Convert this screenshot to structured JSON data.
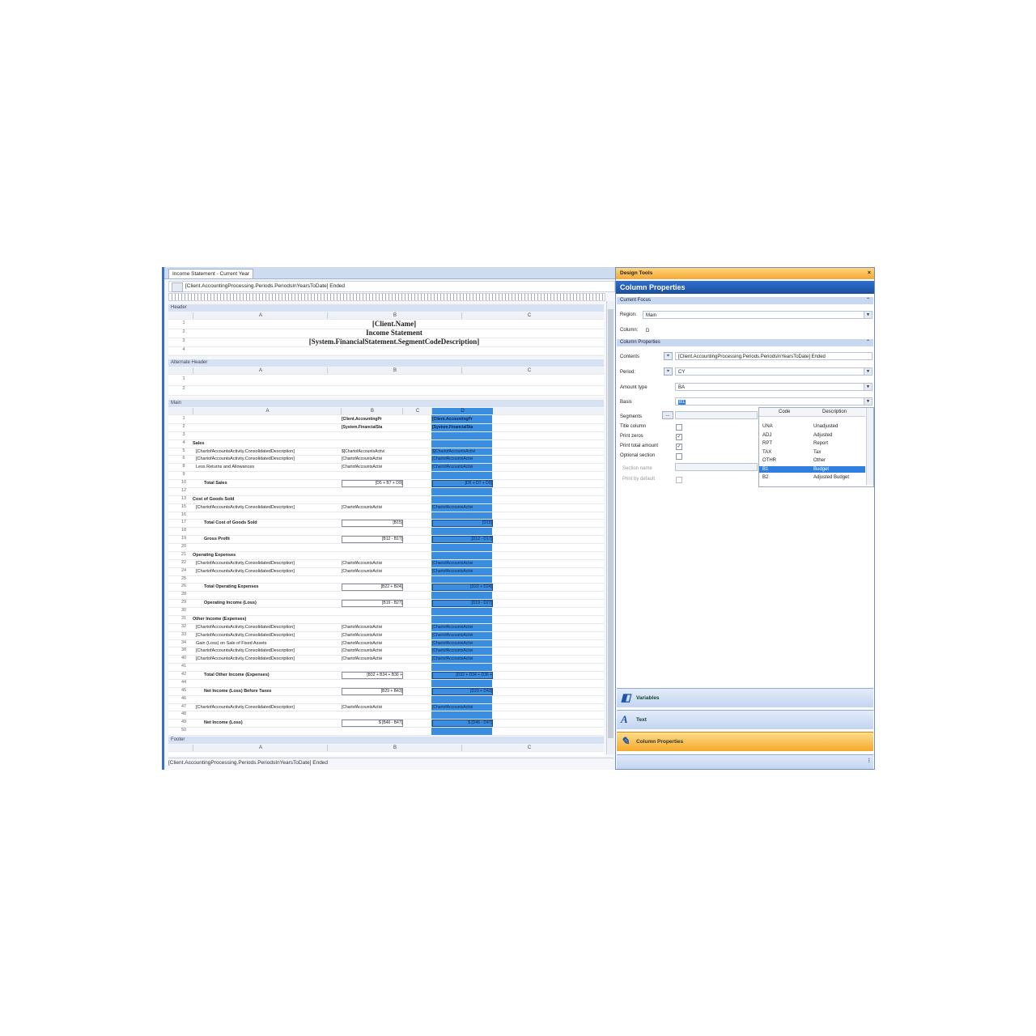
{
  "document_tab": "Income Statement - Current Year",
  "formula_bar": "[Client.AccountingProcessing.Periods.PeriodsInYearsToDate] Ended",
  "sections": {
    "header": "Header",
    "alt_header": "Alternate Header",
    "main": "Main",
    "footer": "Footer"
  },
  "columns": {
    "a": "A",
    "b": "B",
    "c": "C",
    "d": "D"
  },
  "header_rows": [
    {
      "n": "1",
      "text": "[Client.Name]"
    },
    {
      "n": "2",
      "text": "Income Statement"
    },
    {
      "n": "3",
      "text": "[System.FinancialStatement.SegmentCodeDescription]"
    },
    {
      "n": "4",
      "text": ""
    }
  ],
  "alt_header_rows": [
    "1",
    "2"
  ],
  "main_rows": [
    {
      "n": "1",
      "a": "",
      "b": "[Client.AccountingPr",
      "d": "[Client.AccountingPr",
      "bold": true
    },
    {
      "n": "2",
      "a": "",
      "b": "[System.FinancialSta",
      "d": "[System.FinancialSta",
      "bold": true
    },
    {
      "n": "3",
      "a": "",
      "b": "",
      "d": ""
    },
    {
      "n": "4",
      "a": "Sales",
      "b": "",
      "d": "",
      "bold": true
    },
    {
      "n": "5",
      "a": "[ChartofAccountsActivity.ConsolidatedDescription]",
      "b": "$[ChartofAccountsActivi",
      "d": "$[ChartofAccountsActivi"
    },
    {
      "n": "6",
      "a": "[ChartofAccountsActivity.ConsolidatedDescription]",
      "b": "[ChartofAccountsActivi",
      "d": "[ChartofAccountsActivi"
    },
    {
      "n": "8",
      "a": "Less Returns and Allowances",
      "b": "[ChartofAccountsActivi",
      "d": "[ChartofAccountsActivi"
    },
    {
      "n": "9",
      "a": "",
      "b": "",
      "d": ""
    },
    {
      "n": "10",
      "a": "Total Sales",
      "b": "[D5 + B7 + D9]",
      "d": "[D5 + D7 + D9]",
      "bold": true,
      "boxed": true
    },
    {
      "n": "12",
      "a": "",
      "b": "",
      "d": ""
    },
    {
      "n": "13",
      "a": "Cost of Goods Sold",
      "b": "",
      "d": "",
      "bold": true
    },
    {
      "n": "15",
      "a": "[ChartofAccountsActivity.ConsolidatedDescription]",
      "b": "[ChartofAccountsActivi",
      "d": "[ChartofAccountsActivi"
    },
    {
      "n": "16",
      "a": "",
      "b": "",
      "d": ""
    },
    {
      "n": "17",
      "a": "Total Cost of Goods Sold",
      "b": "[B15]",
      "d": "[D15]",
      "bold": true,
      "boxed": true
    },
    {
      "n": "18",
      "a": "",
      "b": "",
      "d": ""
    },
    {
      "n": "19",
      "a": "Gross Profit",
      "b": "[B12 - B17]",
      "d": "[D12 - D17]",
      "bold": true,
      "boxed": true
    },
    {
      "n": "20",
      "a": "",
      "b": "",
      "d": ""
    },
    {
      "n": "21",
      "a": "Operating Expenses",
      "b": "",
      "d": "",
      "bold": true
    },
    {
      "n": "22",
      "a": "[ChartofAccountsActivity.ConsolidatedDescription]",
      "b": "[ChartofAccountsActivi",
      "d": "[ChartofAccountsActivi"
    },
    {
      "n": "24",
      "a": "[ChartofAccountsActivity.ConsolidatedDescription]",
      "b": "[ChartofAccountsActivi",
      "d": "[ChartofAccountsActivi"
    },
    {
      "n": "25",
      "a": "",
      "b": "",
      "d": ""
    },
    {
      "n": "26",
      "a": "Total Operating Expenses",
      "b": "[B22 + B24]",
      "d": "[D22 + D24]",
      "bold": true,
      "boxed": true
    },
    {
      "n": "28",
      "a": "",
      "b": "",
      "d": ""
    },
    {
      "n": "29",
      "a": "Operating Income (Loss)",
      "b": "[B19 - B27]",
      "d": "[D19 - D27]",
      "bold": true,
      "boxed": true
    },
    {
      "n": "30",
      "a": "",
      "b": "",
      "d": ""
    },
    {
      "n": "31",
      "a": "Other Income (Expenses)",
      "b": "",
      "d": "",
      "bold": true
    },
    {
      "n": "32",
      "a": "[ChartofAccountsActivity.ConsolidatedDescription]",
      "b": "[ChartofAccountsActivi",
      "d": "[ChartofAccountsActivi"
    },
    {
      "n": "33",
      "a": "[ChartofAccountsActivity.ConsolidatedDescription]",
      "b": "[ChartofAccountsActivi",
      "d": "[ChartofAccountsActivi"
    },
    {
      "n": "34",
      "a": "Gain (Loss) on Sale of Fixed Assets",
      "b": "[ChartofAccountsActivi",
      "d": "[ChartofAccountsActivi"
    },
    {
      "n": "38",
      "a": "[ChartofAccountsActivity.ConsolidatedDescription]",
      "b": "[ChartofAccountsActivi",
      "d": "[ChartofAccountsActivi"
    },
    {
      "n": "40",
      "a": "[ChartofAccountsActivity.ConsolidatedDescription]",
      "b": "[ChartofAccountsActivi",
      "d": "[ChartofAccountsActivi"
    },
    {
      "n": "41",
      "a": "",
      "b": "",
      "d": ""
    },
    {
      "n": "42",
      "a": "Total Other Income (Expenses)",
      "b": "[B32 + B34 + B36 +",
      "d": "[D32 + D34 + D36 +",
      "bold": true,
      "boxed": true
    },
    {
      "n": "44",
      "a": "",
      "b": "",
      "d": ""
    },
    {
      "n": "45",
      "a": "Net Income (Loss) Before Taxes",
      "b": "[B29 + B43]",
      "d": "[D29 + D43]",
      "bold": true,
      "boxed": true
    },
    {
      "n": "46",
      "a": "",
      "b": "",
      "d": ""
    },
    {
      "n": "47",
      "a": "[ChartofAccountsActivity.ConsolidatedDescription]",
      "b": "[ChartofAccountsActivi",
      "d": "[ChartofAccountsActivi"
    },
    {
      "n": "48",
      "a": "",
      "b": "",
      "d": ""
    },
    {
      "n": "49",
      "a": "Net Income (Loss)",
      "b": "$ [B46 - B47]",
      "d": "$ [D46 - D47]",
      "bold": true,
      "boxed": true
    },
    {
      "n": "50",
      "a": "",
      "b": "",
      "d": ""
    }
  ],
  "status_bar": "[Client.AccountingProcessing.Periods.PeriodsInYearsToDate] Ended",
  "design_tools": {
    "title": "Design Tools",
    "pin": "×"
  },
  "column_properties_title": "Column Properties",
  "current_focus": {
    "header": "Current Focus",
    "region_label": "Region:",
    "region_value": "Main",
    "column_label": "Column:",
    "column_value": "D"
  },
  "column_props": {
    "header": "Column Properties",
    "contents_label": "Contents",
    "contents_value": "[Client.AccountingProcessing.Periods.PeriodsInYearsToDate] Ended",
    "period_label": "Period:",
    "period_value": "CY",
    "amount_type_label": "Amount type",
    "amount_type_value": "BA",
    "basis_label": "Basis",
    "basis_value": "B1",
    "segments_label": "Segments",
    "segments_btn": "...",
    "title_column_label": "Title column",
    "print_zeros_label": "Print zeros",
    "print_total_label": "Print total amount",
    "optional_section_label": "Optional section",
    "section_name_label": "Section name",
    "print_default_label": "Print by default",
    "check": "✓"
  },
  "basis_list": {
    "code_header": "Code",
    "desc_header": "Description",
    "items": [
      {
        "code": "UNA",
        "desc": "Unadjusted"
      },
      {
        "code": "ADJ",
        "desc": "Adjusted"
      },
      {
        "code": "RPT",
        "desc": "Report"
      },
      {
        "code": "TAX",
        "desc": "Tax"
      },
      {
        "code": "OTHR",
        "desc": "Other"
      },
      {
        "code": "B1",
        "desc": "Budget"
      },
      {
        "code": "B2",
        "desc": "Adjusted Budget"
      }
    ]
  },
  "bottom_tabs": {
    "variables": "Variables",
    "text": "Text",
    "column_properties": "Column Properties",
    "text_icon": "A"
  }
}
